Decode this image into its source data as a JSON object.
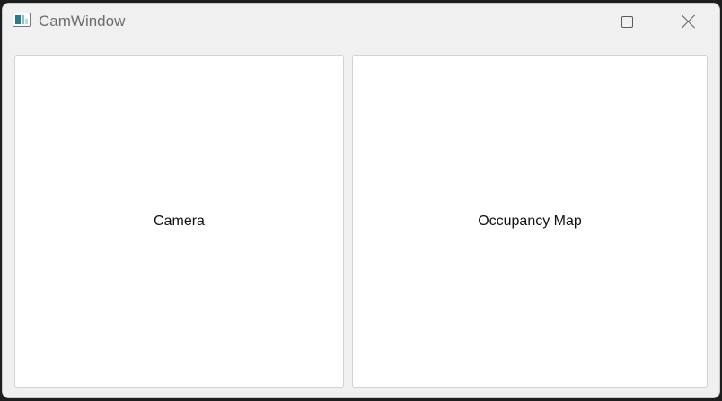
{
  "window": {
    "title": "CamWindow",
    "app_icon": "app-window-icon",
    "controls": {
      "minimize_icon": "minimize-icon",
      "maximize_icon": "maximize-icon",
      "close_icon": "close-icon"
    }
  },
  "panels": {
    "camera": {
      "label": "Camera"
    },
    "occupancy_map": {
      "label": "Occupancy Map"
    }
  },
  "colors": {
    "window_background": "#f0f0f0",
    "panel_background": "#ffffff",
    "title_text": "#6d6d6d"
  }
}
